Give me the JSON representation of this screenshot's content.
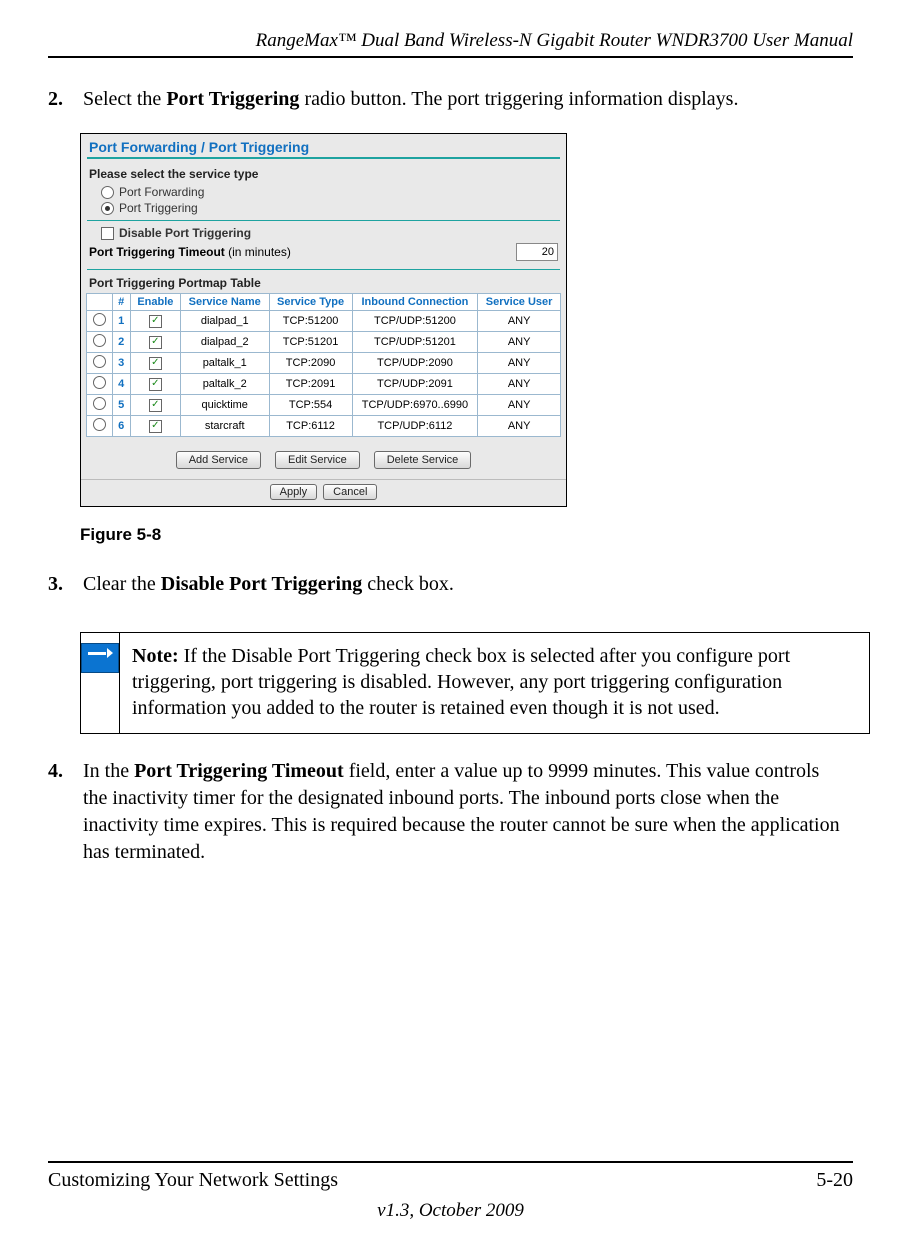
{
  "header": {
    "title": "RangeMax™ Dual Band Wireless-N Gigabit Router WNDR3700 User Manual"
  },
  "steps": {
    "s2": {
      "num": "2.",
      "pre": "Select the ",
      "bold": "Port Triggering",
      "post": " radio button. The port triggering information displays."
    },
    "s3": {
      "num": "3.",
      "pre": "Clear the ",
      "bold": "Disable Port Triggering",
      "post": " check box."
    },
    "s4": {
      "num": "4.",
      "pre": "In the ",
      "bold": "Port Triggering Timeout",
      "post": " field, enter a value up to 9999 minutes. This value controls the inactivity timer for the designated inbound ports. The inbound ports close when the inactivity time expires. This is required because the router cannot be sure when the application has terminated."
    }
  },
  "figure": {
    "caption": "Figure 5-8",
    "panel_title": "Port Forwarding / Port Triggering",
    "select_label": "Please select the service type",
    "radio_forwarding": "Port Forwarding",
    "radio_triggering": "Port Triggering",
    "disable_label": "Disable Port Triggering",
    "timeout_label": "Port Triggering Timeout",
    "timeout_paren": "(in minutes)",
    "timeout_value": "20",
    "portmap_label": "Port Triggering Portmap Table",
    "headers": {
      "num": "#",
      "enable": "Enable",
      "service_name": "Service Name",
      "service_type": "Service Type",
      "inbound": "Inbound Connection",
      "service_user": "Service User"
    },
    "rows": [
      {
        "n": "1",
        "name": "dialpad_1",
        "type": "TCP:51200",
        "inbound": "TCP/UDP:51200",
        "user": "ANY"
      },
      {
        "n": "2",
        "name": "dialpad_2",
        "type": "TCP:51201",
        "inbound": "TCP/UDP:51201",
        "user": "ANY"
      },
      {
        "n": "3",
        "name": "paltalk_1",
        "type": "TCP:2090",
        "inbound": "TCP/UDP:2090",
        "user": "ANY"
      },
      {
        "n": "4",
        "name": "paltalk_2",
        "type": "TCP:2091",
        "inbound": "TCP/UDP:2091",
        "user": "ANY"
      },
      {
        "n": "5",
        "name": "quicktime",
        "type": "TCP:554",
        "inbound": "TCP/UDP:6970..6990",
        "user": "ANY"
      },
      {
        "n": "6",
        "name": "starcraft",
        "type": "TCP:6112",
        "inbound": "TCP/UDP:6112",
        "user": "ANY"
      }
    ],
    "buttons": {
      "add": "Add Service",
      "edit": "Edit Service",
      "delete": "Delete Service",
      "apply": "Apply",
      "cancel": "Cancel"
    }
  },
  "note": {
    "bold": "Note:",
    "text": " If the Disable Port Triggering check box is selected after you configure port triggering, port triggering is disabled. However, any port triggering configuration information you added to the router is retained even though it is not used."
  },
  "footer": {
    "left": "Customizing Your Network Settings",
    "right": "5-20",
    "sub": "v1.3, October 2009"
  }
}
